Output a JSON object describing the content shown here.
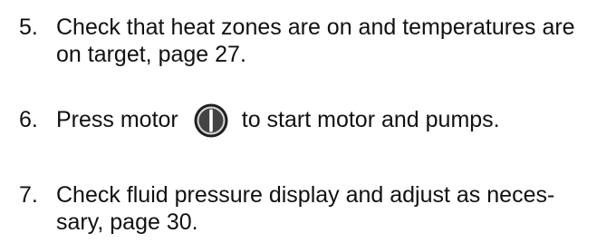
{
  "steps": [
    {
      "number": "5.",
      "lines": [
        "Check that heat zones are on and temperatures are",
        "on target, page 27."
      ]
    },
    {
      "number": "6.",
      "before_icon": "Press motor",
      "icon": "motor-power-icon",
      "after_icon": "to start motor and pumps."
    },
    {
      "number": "7.",
      "lines": [
        "Check fluid pressure display and adjust as neces-",
        "sary, page 30."
      ]
    }
  ]
}
